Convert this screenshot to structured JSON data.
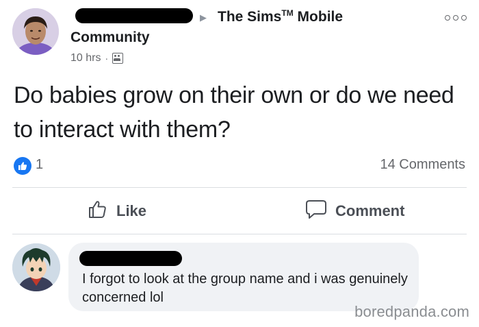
{
  "header": {
    "arrow": "▶",
    "group_name": "The Sims",
    "trademark": "TM",
    "group_name_suffix": "Mobile",
    "group_line2": "Community",
    "time": "10 hrs",
    "dot": "·"
  },
  "post": {
    "text": "Do babies grow on their own or do we need to interact with them?",
    "like_count": "1",
    "comments_count": "14 Comments"
  },
  "actions": {
    "like_label": "Like",
    "comment_label": "Comment"
  },
  "comment": {
    "text": "I forgot to look at the group name and i was genuinely concerned lol"
  },
  "watermark": "boredpanda.com",
  "icons": {
    "more": "more-options-icon",
    "group": "group-privacy-icon",
    "like_badge": "thumbs-up-icon",
    "like_action": "thumbs-up-outline-icon",
    "comment_action": "speech-bubble-icon"
  },
  "colors": {
    "facebook_blue": "#1877f2",
    "secondary_text": "#65676b",
    "comment_bubble": "#f0f2f5",
    "redaction": "#000000"
  }
}
